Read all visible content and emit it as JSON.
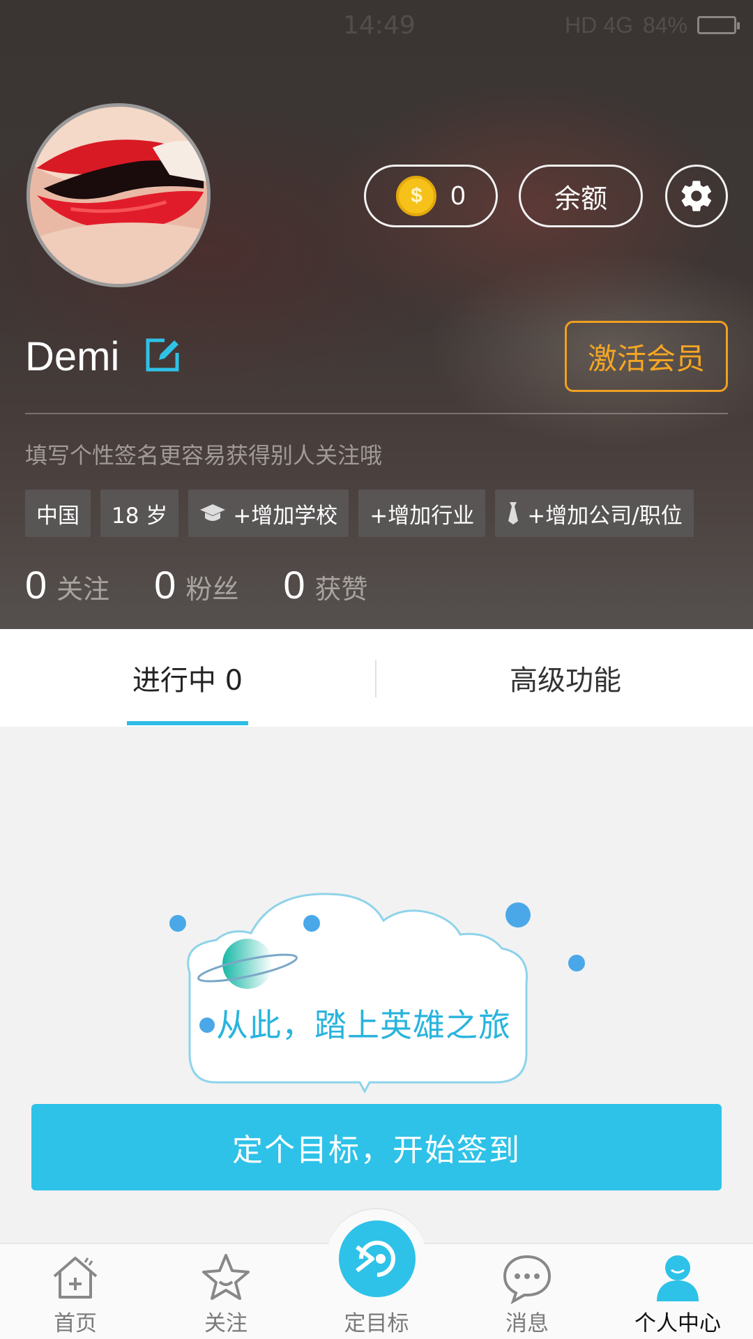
{
  "status_bar": {
    "time": "14:49",
    "network": "HD 4G",
    "battery": "84%",
    "battery_level": 0.84
  },
  "profile": {
    "username": "Demi",
    "coins": "0",
    "balance_label": "余额",
    "vip_label": "激活会员",
    "signature_placeholder": "填写个性签名更容易获得别人关注哦",
    "tags": [
      {
        "label": "中国",
        "icon": ""
      },
      {
        "label": "18 岁",
        "icon": ""
      },
      {
        "label": "+增加学校",
        "icon": "graduation-cap-icon"
      },
      {
        "label": "+增加行业",
        "icon": ""
      },
      {
        "label": "+增加公司/职位",
        "icon": "tie-icon"
      }
    ],
    "stats": [
      {
        "value": "0",
        "label": "关注"
      },
      {
        "value": "0",
        "label": "粉丝"
      },
      {
        "value": "0",
        "label": "获赞"
      }
    ]
  },
  "tabs": [
    {
      "label": "进行中 0",
      "active": true
    },
    {
      "label": "高级功能",
      "active": false
    }
  ],
  "empty_state": {
    "text": "从此，踏上英雄之旅",
    "cta_label": "定个目标，开始签到"
  },
  "bottom_nav": [
    {
      "label": "首页",
      "icon": "home-icon"
    },
    {
      "label": "关注",
      "icon": "star-icon"
    },
    {
      "label": "定目标",
      "icon": "goal-icon"
    },
    {
      "label": "消息",
      "icon": "message-icon"
    },
    {
      "label": "个人中心",
      "icon": "profile-icon",
      "active": true
    }
  ],
  "colors": {
    "accent": "#2ec2e8",
    "vip": "#f5a623",
    "coin": "#f6c21a"
  }
}
